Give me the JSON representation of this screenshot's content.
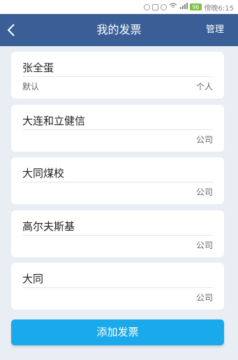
{
  "status_bar": {
    "time_text": "傍晚6:15",
    "battery": "96"
  },
  "header": {
    "title": "我的发票",
    "manage_label": "管理"
  },
  "invoices": [
    {
      "name": "张全蛋",
      "default_label": "默认",
      "type": "个人"
    },
    {
      "name": "大连和立健信",
      "default_label": "",
      "type": "公司"
    },
    {
      "name": "大同煤校",
      "default_label": "",
      "type": "公司"
    },
    {
      "name": "高尔夫斯基",
      "default_label": "",
      "type": "公司"
    },
    {
      "name": "大同",
      "default_label": "",
      "type": "公司"
    }
  ],
  "add_button_label": "添加发票",
  "colors": {
    "header": "#3a5f97",
    "accent": "#1aa9ea",
    "background": "#e9edf4"
  }
}
